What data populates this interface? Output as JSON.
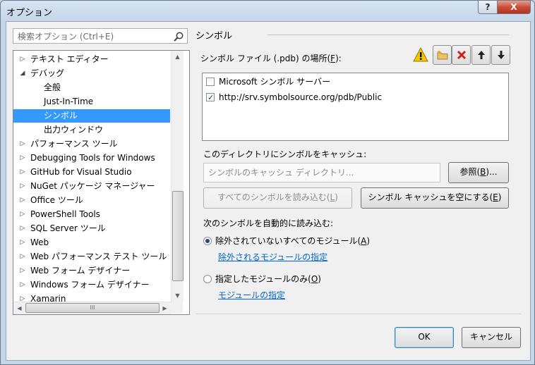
{
  "window": {
    "title": "オプション",
    "help_label": "?",
    "close_label": "X"
  },
  "search": {
    "placeholder": "検索オプション (Ctrl+E)"
  },
  "tree": {
    "items": [
      {
        "label": "テキスト エディター",
        "arrow": "▷",
        "indent": 0
      },
      {
        "label": "デバッグ",
        "arrow": "◢",
        "indent": 0
      },
      {
        "label": "全般",
        "arrow": "",
        "indent": 1
      },
      {
        "label": "Just-In-Time",
        "arrow": "",
        "indent": 1
      },
      {
        "label": "シンボル",
        "arrow": "",
        "indent": 1,
        "selected": true
      },
      {
        "label": "出力ウィンドウ",
        "arrow": "",
        "indent": 1
      },
      {
        "label": "パフォーマンス ツール",
        "arrow": "▷",
        "indent": 0
      },
      {
        "label": "Debugging Tools for Windows",
        "arrow": "▷",
        "indent": 0
      },
      {
        "label": "GitHub for Visual Studio",
        "arrow": "▷",
        "indent": 0
      },
      {
        "label": "NuGet パッケージ マネージャー",
        "arrow": "▷",
        "indent": 0
      },
      {
        "label": "Office ツール",
        "arrow": "▷",
        "indent": 0
      },
      {
        "label": "PowerShell Tools",
        "arrow": "▷",
        "indent": 0
      },
      {
        "label": "SQL Server ツール",
        "arrow": "▷",
        "indent": 0
      },
      {
        "label": "Web",
        "arrow": "▷",
        "indent": 0
      },
      {
        "label": "Web パフォーマンス テスト ツール",
        "arrow": "▷",
        "indent": 0
      },
      {
        "label": "Web フォーム デザイナー",
        "arrow": "▷",
        "indent": 0
      },
      {
        "label": "Windows フォーム デザイナー",
        "arrow": "▷",
        "indent": 0
      },
      {
        "label": "Xamarin",
        "arrow": "▷",
        "indent": 0
      }
    ],
    "scroll": {
      "up": "▲",
      "down": "▼",
      "left": "◀",
      "right": "▶",
      "grip": "III"
    }
  },
  "symbols": {
    "section_title": "シンボル",
    "file_locations_label": "シンボル ファイル (.pdb) の場所(",
    "file_locations_key": "F",
    "file_locations_suffix": "):",
    "locations": [
      {
        "label": "Microsoft シンボル サーバー",
        "checked": false
      },
      {
        "label": "http://srv.symbolsource.org/pdb/Public",
        "checked": true
      }
    ],
    "cache_label": "このディレクトリにシンボルをキャッシュ:",
    "cache_placeholder": "シンボルのキャッシュ ディレクトリ...",
    "browse_label": "参照(",
    "browse_key": "B",
    "browse_suffix": ")...",
    "load_all_label": "すべてのシンボルを読み込む(",
    "load_all_key": "L",
    "load_all_suffix": ")",
    "empty_cache_label": "シンボル キャッシュを空にする(",
    "empty_cache_key": "E",
    "empty_cache_suffix": ")",
    "auto_load_label": "次のシンボルを自動的に読み込む:",
    "option_all_label": "除外されていないすべてのモジュール(",
    "option_all_key": "A",
    "option_all_suffix": ")",
    "exclude_link": "除外されるモジュールの指定",
    "option_only_label": "指定したモジュールのみ(",
    "option_only_key": "O",
    "option_only_suffix": ")",
    "modules_link": "モジュールの指定"
  },
  "footer": {
    "ok_label": "OK",
    "cancel_label": "キャンセル"
  },
  "colors": {
    "accent": "#3399ff",
    "link": "#0066cc",
    "delete": "#cc2020",
    "warning": "#f5c400"
  }
}
